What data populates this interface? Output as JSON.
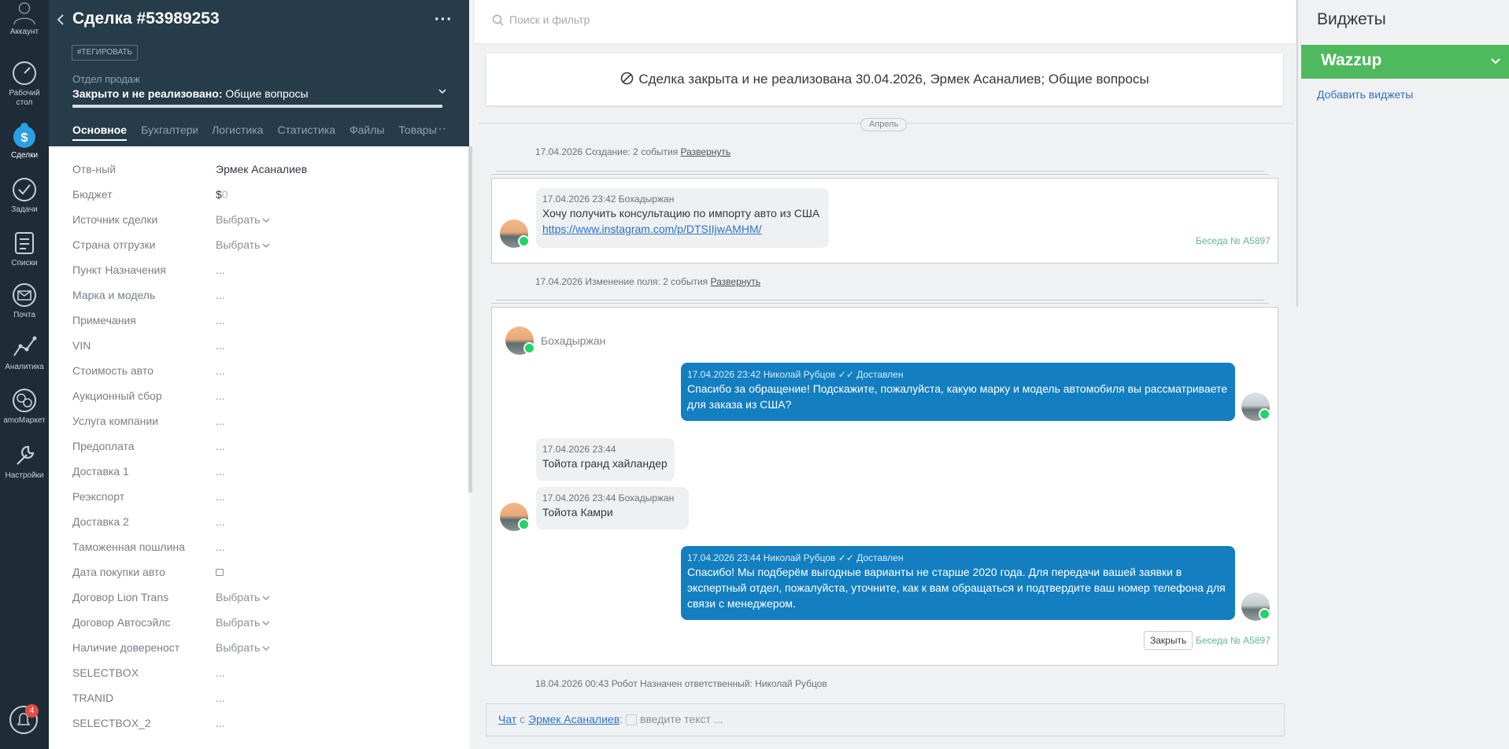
{
  "nav": {
    "items": [
      {
        "label": "Аккаунт",
        "icon": "account-icon"
      },
      {
        "label": "Рабочий стол",
        "icon": "dashboard-icon"
      },
      {
        "label": "Сделки",
        "icon": "deals-icon"
      },
      {
        "label": "Задачи",
        "icon": "tasks-icon"
      },
      {
        "label": "Списки",
        "icon": "lists-icon"
      },
      {
        "label": "Почта",
        "icon": "mail-icon"
      },
      {
        "label": "Аналитика",
        "icon": "analytics-icon"
      },
      {
        "label": "amoМаркет",
        "icon": "market-icon"
      },
      {
        "label": "Настройки",
        "icon": "settings-icon"
      }
    ],
    "notifications_count": "4"
  },
  "deal": {
    "title": "Сделка #53989253",
    "tag_button": "#ТЕГИРОВАТЬ",
    "department": "Отдел продаж",
    "stage_bold": "Закрыто и не реализовано:",
    "stage_reason": " Общие вопросы",
    "tabs": [
      "Основное",
      "Бухгалтерия",
      "Логистика",
      "Статистика",
      "Файлы",
      "Товары"
    ],
    "tabs_more": "···",
    "fields": [
      {
        "label": "Отв-ный",
        "value": "Эрмек Асаналиев",
        "kind": "text"
      },
      {
        "label": "Бюджет",
        "value": "$",
        "value2": "0",
        "kind": "budget"
      },
      {
        "label": "Источник сделки",
        "value": "Выбрать",
        "kind": "select"
      },
      {
        "label": "Страна отгрузки",
        "value": "Выбрать",
        "kind": "select"
      },
      {
        "label": "Пункт Назначения",
        "value": "...",
        "kind": "empty"
      },
      {
        "label": "Марка и модель",
        "value": "...",
        "kind": "empty"
      },
      {
        "label": "Примечания",
        "value": "...",
        "kind": "empty"
      },
      {
        "label": "VIN",
        "value": "...",
        "kind": "empty"
      },
      {
        "label": "Стоимость авто",
        "value": "...",
        "kind": "empty"
      },
      {
        "label": "Аукционный сбор",
        "value": "...",
        "kind": "empty"
      },
      {
        "label": "Услуга компании",
        "value": "...",
        "kind": "empty"
      },
      {
        "label": "Предоплата",
        "value": "...",
        "kind": "empty"
      },
      {
        "label": "Доставка 1",
        "value": "...",
        "kind": "empty"
      },
      {
        "label": "Реэкспорт",
        "value": "...",
        "kind": "empty"
      },
      {
        "label": "Доставка 2",
        "value": "...",
        "kind": "empty"
      },
      {
        "label": "Таможенная пошлина",
        "value": "...",
        "kind": "empty"
      },
      {
        "label": "Дата покупки авто",
        "value": "",
        "kind": "date"
      },
      {
        "label": "Договор Lion Trans",
        "value": "Выбрать",
        "kind": "select"
      },
      {
        "label": "Договор Автосэйлс",
        "value": "Выбрать",
        "kind": "select"
      },
      {
        "label": "Наличие довереност",
        "value": "Выбрать",
        "kind": "select"
      },
      {
        "label": "SELECTBOX",
        "value": "...",
        "kind": "empty"
      },
      {
        "label": "TRANID",
        "value": "...",
        "kind": "empty"
      },
      {
        "label": "SELECTBOX_2",
        "value": "...",
        "kind": "empty"
      }
    ]
  },
  "feed": {
    "search_placeholder": "Поиск и фильтр",
    "closed_banner": "Сделка закрыта и не реализована 30.04.2026, Эрмек Асаналиев; Общие вопросы",
    "month_label": "Апрель",
    "event1": {
      "text": "17.04.2026 Создание: 2 события ",
      "link": "Развернуть"
    },
    "card1": {
      "meta": "17.04.2026 23:42 Бохадыржан",
      "text": "Хочу получить консультацию по импорту авто из США",
      "link": "https://www.instagram.com/p/DTSIIjwAMHM/",
      "conversation": "Беседа № A5897"
    },
    "event2": {
      "text": "17.04.2026 Изменение поля: 2 события ",
      "link": "Развернуть"
    },
    "card2": {
      "sender": "Бохадыржан",
      "msg1_meta": "17.04.2026 23:42 Николай Рубцов",
      "msg1_status": "Доставлен",
      "msg1_text": "Спасибо за обращение! Подскажите, пожалуйста, какую марку и модель автомобиля вы рассматриваете для заказа из США?",
      "msg2_meta": "17.04.2026 23:44",
      "msg2_text": "Тойота гранд хайландер",
      "msg3_meta": "17.04.2026 23:44 Бохадыржан",
      "msg3_text": "Тойота Камри",
      "msg4_meta": "17.04.2026 23:44 Николай Рубцов",
      "msg4_status": "Доставлен",
      "msg4_text": "Спасибо! Мы подберём выгодные варианты не старше 2020 года. Для передачи вашей заявки в экспертный отдел, пожалуйста, уточните, как к вам обращаться и подтвердите ваш номер телефона для связи с менеджером.",
      "close_button": "Закрыть",
      "conversation": "Беседа № A5897"
    },
    "event3": {
      "text": "18.04.2026 00:43 Робот Назначен ответственный: Николай Рубцов"
    },
    "chat_bar": {
      "chat_link": "Чат",
      "with": " с ",
      "contact": "Эрмек Асаналиев",
      "colon": ":",
      "placeholder": "введите текст ..."
    }
  },
  "widgets": {
    "title": "Виджеты",
    "wazzup": "Wazzup",
    "add_link": "Добавить виджеты"
  }
}
